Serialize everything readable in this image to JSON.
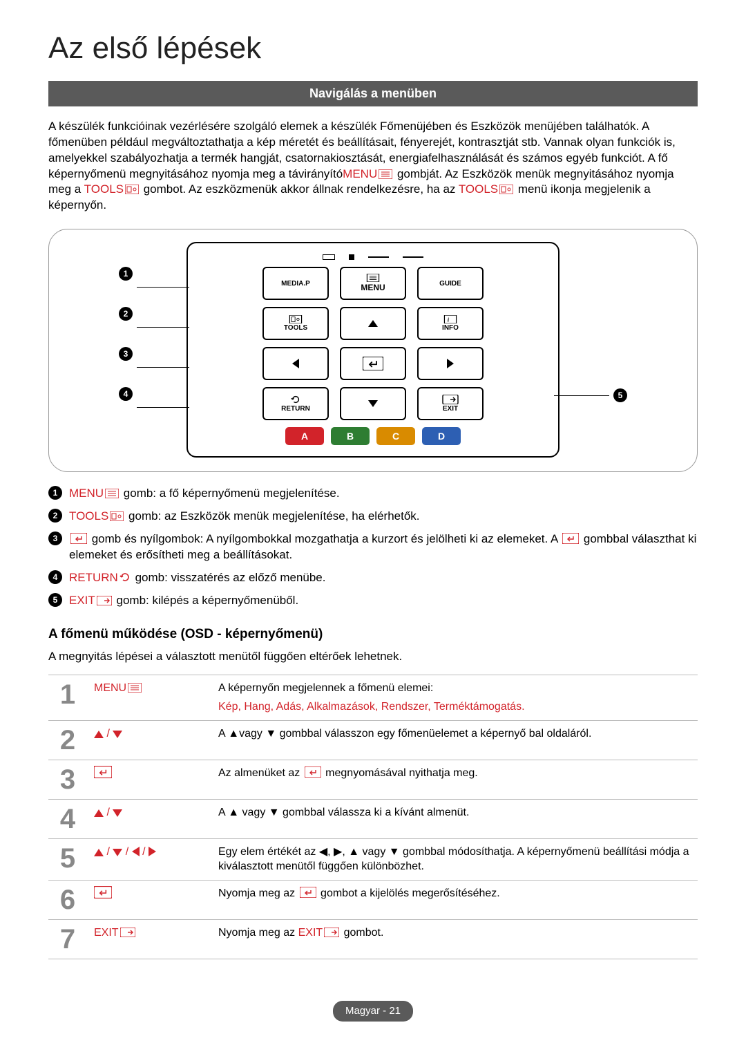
{
  "pageTitle": "Az első lépések",
  "sectionBar": "Navigálás a menüben",
  "intro": {
    "p1": "A készülék funkcióinak vezérlésére szolgáló elemek a készülék Főmenüjében és Eszközök menüjében találhatók. A főmenüben például megváltoztathatja a kép méretét és beállításait, fényerejét, kontrasztját stb. Vannak olyan funkciók is, amelyekkel szabályozhatja a termék hangját, csatornakiosztását, energiafelhasználását és számos egyéb funkciót. A fő képernyőmenü megnyitásához nyomja meg a távirányító",
    "menuWord": "MENU",
    "p1b": " gombját. Az Eszközök menük megnyitásához nyomja meg a ",
    "toolsWord": "TOOLS",
    "p1c": " gombot. Az eszközmenük akkor állnak rendelkezésre, ha az ",
    "p1d": " menü ikonja megjelenik a képernyőn."
  },
  "remote": {
    "mediap": "MEDIA.P",
    "menu": "MENU",
    "guide": "GUIDE",
    "tools": "TOOLS",
    "info": "INFO",
    "return": "RETURN",
    "exit": "EXIT",
    "colors": {
      "a": "A",
      "b": "B",
      "c": "C",
      "d": "D"
    }
  },
  "legend": {
    "i1a": "MENU",
    "i1b": " gomb: a fő képernyőmenü megjelenítése.",
    "i2a": "TOOLS",
    "i2b": " gomb: az Eszközök menük megjelenítése, ha elérhetők.",
    "i3a": " gomb és nyílgombok: A nyílgombokkal mozgathatja a kurzort és jelölheti ki az elemeket. A ",
    "i3b": " gombbal választhat ki elemeket és erősítheti meg a beállításokat.",
    "i4a": "RETURN",
    "i4b": " gomb: visszatérés az előző menübe.",
    "i5a": "EXIT",
    "i5b": " gomb: kilépés a képernyőmenüből."
  },
  "subHeading": "A főmenü működése (OSD - képernyőmenü)",
  "note": "A megnyitás lépései a választott menütől függően eltérőek lehetnek.",
  "steps": {
    "s1": {
      "n": "1",
      "key": "MENU",
      "d1": "A képernyőn megjelennek a főmenü elemei:",
      "cats": [
        "Kép",
        "Hang",
        "Adás",
        "Alkalmazások",
        "Rendszer",
        "Terméktámogatás"
      ]
    },
    "s2": {
      "n": "2",
      "d": "A ▲vagy ▼ gombbal válasszon egy főmenüelemet a képernyő bal oldaláról."
    },
    "s3": {
      "n": "3",
      "d1": "Az almenüket az ",
      "d2": " megnyomásával nyithatja meg."
    },
    "s4": {
      "n": "4",
      "d": "A ▲ vagy ▼ gombbal válassza ki a kívánt almenüt."
    },
    "s5": {
      "n": "5",
      "d": "Egy elem értékét az ◀, ▶, ▲ vagy ▼ gombbal módosíthatja. A képernyőmenü beállítási módja a kiválasztott menütől függően különbözhet."
    },
    "s6": {
      "n": "6",
      "d1": "Nyomja meg az ",
      "d2": " gombot a kijelölés megerősítéséhez."
    },
    "s7": {
      "n": "7",
      "key": "EXIT",
      "d1": "Nyomja meg az ",
      "d2": "EXIT",
      "d3": " gombot."
    }
  },
  "footer": {
    "lang": "Magyar",
    "page": "21"
  }
}
